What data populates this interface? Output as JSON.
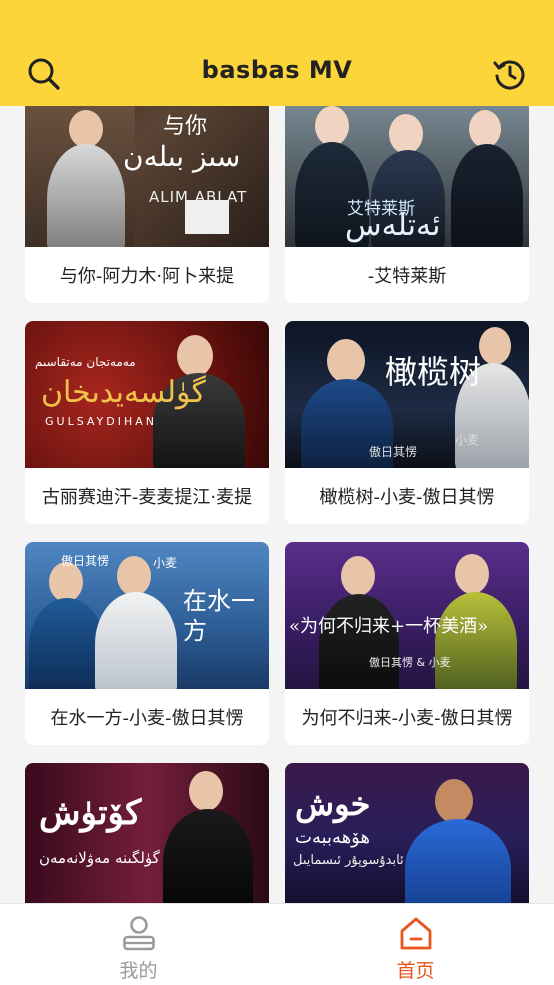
{
  "header": {
    "title": "basbas  MV",
    "search_icon": "search-icon",
    "history_icon": "history-icon",
    "accent_color": "#fcd53a"
  },
  "cards": [
    {
      "caption": "与你-阿力木·阿卜来提",
      "overlay": [
        "与你",
        "سىز بىلەن",
        "ALIM ABLAT"
      ]
    },
    {
      "caption": "-艾特莱斯",
      "overlay": [
        "艾特莱斯",
        "ئەتلەس"
      ]
    },
    {
      "caption": "古丽赛迪汗-麦麦提江·麦提",
      "overlay": [
        "مەمەتجان مەتقاسىم",
        "گۈلسەيدىخان",
        "GULSAYDIHAN"
      ]
    },
    {
      "caption": "橄榄树-小麦-傲日其愣",
      "overlay": [
        "橄榄树",
        "傲日其愣",
        "小麦"
      ]
    },
    {
      "caption": "在水一方-小麦-傲日其愣",
      "overlay": [
        "傲日其愣",
        "小麦",
        "在水一方"
      ]
    },
    {
      "caption": "为何不归来-小麦-傲日其愣",
      "overlay": [
        "«为何不归来+一杯美酒»",
        "傲日其愣 & 小麦"
      ]
    },
    {
      "caption": "",
      "overlay": [
        "كۆتۈش",
        "گۈلگىنە مەۋلانەمەن"
      ]
    },
    {
      "caption": "",
      "overlay": [
        "خوش",
        "ھۆھەببەت",
        "ئابدۇسوپۇر ئىسمايىل"
      ]
    }
  ],
  "tabbar": {
    "items": [
      {
        "label": "我的",
        "icon": "person-icon",
        "active": false
      },
      {
        "label": "首页",
        "icon": "home-icon",
        "active": true
      }
    ],
    "active_color": "#e8541e",
    "inactive_color": "#9a9a9a"
  }
}
